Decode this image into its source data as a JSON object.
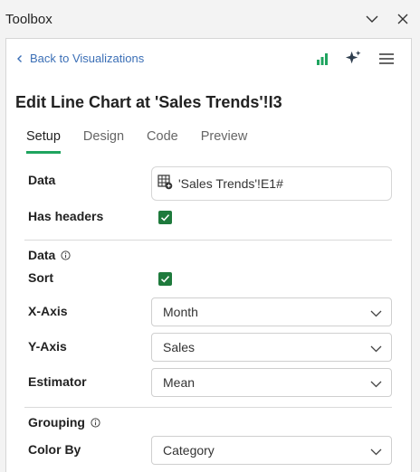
{
  "window": {
    "title": "Toolbox"
  },
  "header": {
    "back_label": "Back to Visualizations"
  },
  "heading": "Edit Line Chart at 'Sales Trends'!I3",
  "tabs": [
    {
      "label": "Setup",
      "active": true
    },
    {
      "label": "Design",
      "active": false
    },
    {
      "label": "Code",
      "active": false
    },
    {
      "label": "Preview",
      "active": false
    }
  ],
  "form": {
    "data_label": "Data",
    "data_value": "'Sales Trends'!E1#",
    "has_headers_label": "Has headers",
    "has_headers_checked": true,
    "data_section_label": "Data",
    "sort_label": "Sort",
    "sort_checked": true,
    "xaxis_label": "X-Axis",
    "xaxis_value": "Month",
    "yaxis_label": "Y-Axis",
    "yaxis_value": "Sales",
    "estimator_label": "Estimator",
    "estimator_value": "Mean",
    "grouping_label": "Grouping",
    "colorby_label": "Color By",
    "colorby_value": "Category"
  },
  "colors": {
    "accent": "#1fa45f",
    "checkbox": "#1e7a3c",
    "link": "#3b6fb6"
  }
}
